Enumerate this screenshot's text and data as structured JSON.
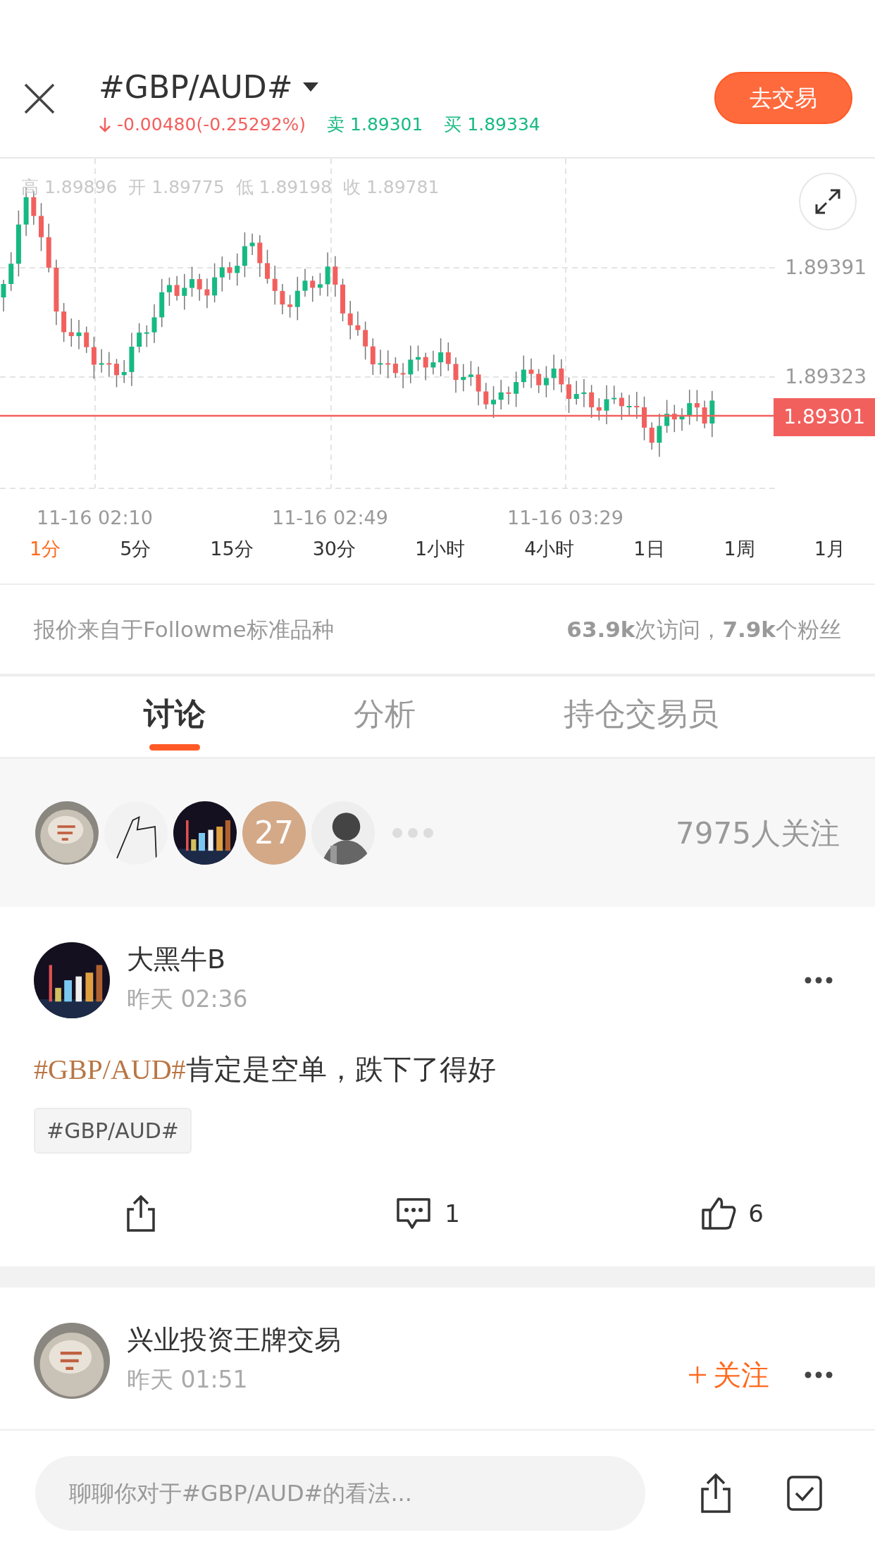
{
  "header": {
    "title": "#GBP/AUD#",
    "change": "-0.00480(-0.25292%)",
    "sell": "卖 1.89301",
    "buy": "买 1.89334",
    "trade_button": "去交易"
  },
  "chart": {
    "ohlc": [
      "高 1.89896",
      "开 1.89775",
      "低 1.89198",
      "收 1.89781"
    ],
    "price_labels": [
      "1.89391",
      "1.89323"
    ],
    "current_price": "1.89301",
    "time_labels": [
      "11-16 02:10",
      "11-16 02:49",
      "11-16 03:29"
    ]
  },
  "timeframes": [
    {
      "label": "1分",
      "selected": true
    },
    {
      "label": "5分",
      "selected": false
    },
    {
      "label": "15分",
      "selected": false
    },
    {
      "label": "30分",
      "selected": false
    },
    {
      "label": "1小时",
      "selected": false
    },
    {
      "label": "4小时",
      "selected": false
    },
    {
      "label": "1日",
      "selected": false
    },
    {
      "label": "1周",
      "selected": false
    },
    {
      "label": "1月",
      "selected": false
    }
  ],
  "source": "报价来自于Followme标准品种",
  "stats": "**63.9k**次访问，**7.9k**个粉丝",
  "tabs": [
    {
      "label": "讨论",
      "selected": true
    },
    {
      "label": "分析",
      "selected": false
    },
    {
      "label": "持仓交易员",
      "selected": false
    }
  ],
  "followers": {
    "avatars": [
      {
        "kind": "picture"
      },
      {
        "kind": "picture"
      },
      {
        "kind": "picture"
      },
      {
        "kind": "count",
        "text": "27"
      },
      {
        "kind": "picture"
      }
    ],
    "count": "7975人关注"
  },
  "posts": [
    {
      "author": "大黑牛B",
      "time": "昨天 02:36",
      "hashtag": "#GBP/AUD#",
      "text": "肯定是空单，跌下了得好",
      "tag": "#GBP/AUD#",
      "comments": "1",
      "likes": "6"
    },
    {
      "author": "兴业投资王牌交易",
      "time": "昨天 01:51",
      "follow": "关注"
    }
  ],
  "composer": {
    "placeholder": "聊聊你对于#GBP/AUD#的看法..."
  }
}
